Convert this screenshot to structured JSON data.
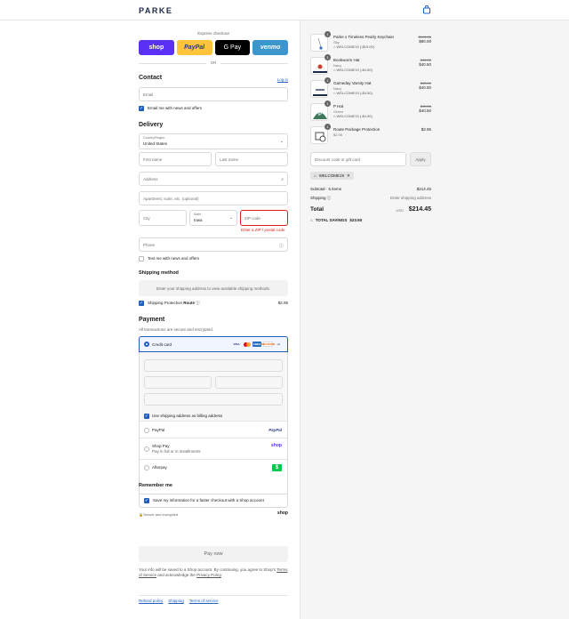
{
  "header": {
    "logo": "PARKE",
    "cart_icon": "shopping-bag-icon"
  },
  "express": {
    "label": "Express checkout",
    "buttons": [
      "shop",
      "PayPal",
      "G Pay",
      "venmo"
    ],
    "or": "OR"
  },
  "contact": {
    "title": "Contact",
    "login": "Log in",
    "email_placeholder": "Email",
    "news_label": "Email me with news and offers"
  },
  "delivery": {
    "title": "Delivery",
    "country_label": "Country/Region",
    "country_value": "United States",
    "first_name": "First name",
    "last_name": "Last name",
    "address": "Address",
    "apartment": "Apartment, suite, etc. (optional)",
    "city": "City",
    "state_label": "State",
    "state_value": "Iowa",
    "zip": "ZIP code",
    "zip_error": "Enter a ZIP / postal code",
    "phone": "Phone",
    "text_label": "Text me with news and offers"
  },
  "shipping": {
    "title": "Shipping method",
    "note": "Enter your shipping address to view available shipping methods.",
    "protection_label": "Shipping Protection",
    "route": "Route",
    "protection_price": "$2.95"
  },
  "payment": {
    "title": "Payment",
    "subtitle": "All transactions are secure and encrypted.",
    "credit_card": "Credit card",
    "card_logos": [
      "VISA",
      "MC",
      "AMEX",
      "DISCOVER",
      "+4"
    ],
    "billing_label": "Use shipping address as billing address",
    "paypal": "PayPal",
    "paypal_logo": "PayPal",
    "shop_pay": "Shop Pay",
    "shop_pay_sub": "Pay in full or in installments",
    "shop_logo": "shop",
    "afterpay": "Afterpay",
    "afterpay_logo": "$"
  },
  "remember": {
    "title": "Remember me",
    "save_label": "Save my information for a faster checkout with a Shop account",
    "secure": "Secure and encrypted",
    "shop_logo": "shop"
  },
  "pay_now": "Pay now",
  "legal": {
    "text1": "Your info will be saved to a Shop account. By continuing, you agree to Shop's",
    "tos": "Terms of Service",
    "text2": "and acknowledge the",
    "privacy": "Privacy Policy",
    "end": "."
  },
  "footer": [
    "Refund policy",
    "Shipping",
    "Terms of service"
  ],
  "order": {
    "items": [
      {
        "qty": "1",
        "name": "Parke x Timeless Pearly Keychain",
        "variant": "Sky",
        "discount": "WELCOME19 (-$19.00)",
        "old_price": "$100.00",
        "price": "$80.00"
      },
      {
        "qty": "1",
        "name": "Bookworm Hat",
        "variant": "Navy",
        "discount": "WELCOME19 (-$4.50)",
        "old_price": "$45.00",
        "price": "$40.50"
      },
      {
        "qty": "1",
        "name": "Gameday Varsity Hat",
        "variant": "Navy",
        "discount": "WELCOME19 (-$4.50)",
        "old_price": "$45.00",
        "price": "$40.50"
      },
      {
        "qty": "1",
        "name": "P Hat",
        "variant": "Green",
        "discount": "WELCOME19 (-$4.50)",
        "old_price": "$45.00",
        "price": "$40.50"
      },
      {
        "qty": "1",
        "name": "Route Package Protection",
        "variant": "$2.95",
        "discount": "",
        "old_price": "",
        "price": "$2.95"
      }
    ],
    "discount_placeholder": "Discount code or gift card",
    "apply": "Apply",
    "code_chip": "WELCOME19",
    "subtotal_label": "Subtotal · 5 items",
    "subtotal": "$214.45",
    "shipping_label": "Shipping",
    "shipping_value": "Enter shipping address",
    "total_label": "Total",
    "currency": "USD",
    "total": "$214.45",
    "savings_label": "TOTAL SAVINGS",
    "savings": "$23.50"
  }
}
